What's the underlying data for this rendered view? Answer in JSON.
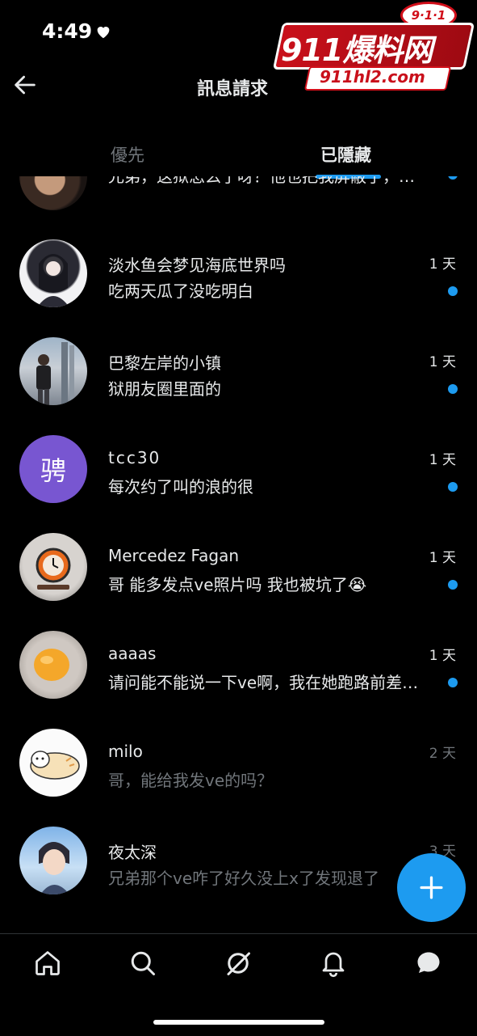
{
  "status_bar": {
    "time": "4:49"
  },
  "watermark": {
    "badge": "9·1·1",
    "main": "911爆料网",
    "sub": "911hl2.com"
  },
  "header": {
    "title": "訊息請求"
  },
  "tabs": [
    {
      "label": "優先",
      "selected": false
    },
    {
      "label": "已隱藏",
      "selected": true
    }
  ],
  "conversations": [
    {
      "name": "",
      "preview": "兄弟，这狱怎么了呀？他也把我屏蔽了，…",
      "time": "",
      "unread": true,
      "avatar": "photo-man"
    },
    {
      "name": "淡水鱼会梦见海底世界吗",
      "preview": "吃两天瓜了没吃明白",
      "time": "1 天",
      "unread": true,
      "avatar": "anime-girl"
    },
    {
      "name": "巴黎左岸的小镇",
      "preview": "狱朋友圈里面的",
      "time": "1 天",
      "unread": true,
      "avatar": "photo-street"
    },
    {
      "name": "tcc30",
      "preview": "每次约了叫的浪的很",
      "time": "1 天",
      "unread": true,
      "avatar": "letter",
      "avatar_letter": "骋",
      "avatar_color": "#7856d1"
    },
    {
      "name": "Mercedez Fagan",
      "preview": "哥 能多发点ve照片吗 我也被坑了😭",
      "time": "1 天",
      "unread": true,
      "avatar": "clock"
    },
    {
      "name": "aaaas",
      "preview": "请问能不能说一下ve啊，我在她跑路前差…",
      "time": "1 天",
      "unread": true,
      "avatar": "fruit"
    },
    {
      "name": "milo",
      "preview": "哥，能给我发ve的吗？",
      "time": "2 天",
      "unread": false,
      "avatar": "cat"
    },
    {
      "name": "夜太深",
      "preview": "兄弟那个ve咋了好久没上x了发现退了",
      "time": "3 天",
      "unread": false,
      "avatar": "anime-boy"
    }
  ],
  "colors": {
    "accent": "#1d9bf0",
    "muted": "#71767b",
    "background": "#000000"
  },
  "tabbar": [
    "home-icon",
    "search-icon",
    "grok-icon",
    "bell-icon",
    "messages-icon"
  ]
}
